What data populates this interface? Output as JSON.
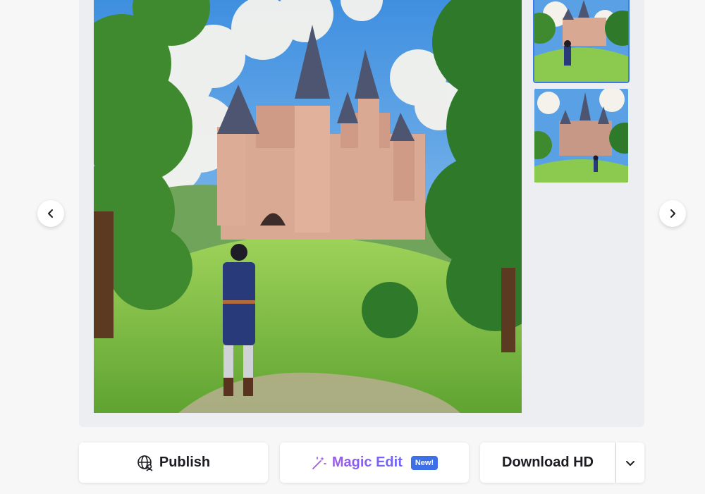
{
  "gallery": {
    "main_image_alt": "anime castle on a hill with a boy in a blue coat",
    "thumbnails": [
      {
        "alt": "castle thumbnail 1",
        "selected": true
      },
      {
        "alt": "castle thumbnail 2",
        "selected": false
      }
    ],
    "prev_icon": "chevron-left-icon",
    "next_icon": "chevron-right-icon"
  },
  "actions": {
    "publish_label": "Publish",
    "publish_icon": "globe-user-icon",
    "magic_label": "Magic Edit",
    "magic_icon": "magic-wand-icon",
    "magic_badge": "New!",
    "download_label": "Download HD",
    "more_icon": "chevron-down-icon"
  },
  "colors": {
    "accent_blue": "#3d6fe6",
    "magic_purple": "#8a5ad8",
    "thumb_selected_border": "#3d7be8"
  }
}
